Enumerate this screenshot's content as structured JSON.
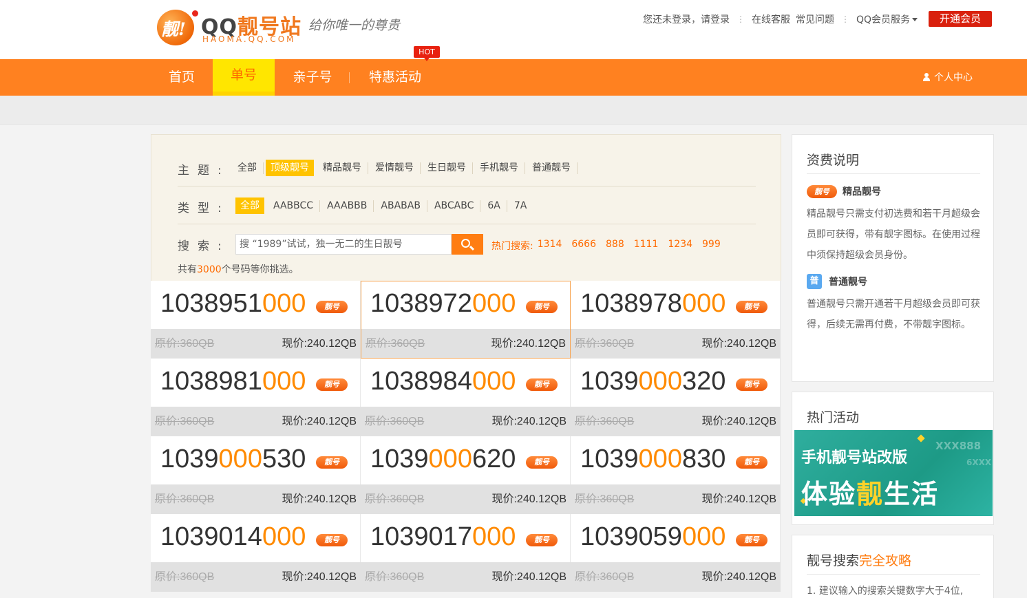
{
  "header": {
    "logo": {
      "badge": "靓!",
      "title_a": "QQ",
      "title_b": "靓号站",
      "domain": "HAOMA.QQ.COM",
      "slogan": "给你唯一的尊贵"
    },
    "links": {
      "login_prompt": "您还未登录，请登录",
      "online_service": "在线客服",
      "faq": "常见问题",
      "vip_service": "QQ会员服务"
    },
    "vip_button": "开通会员"
  },
  "nav": {
    "items": [
      {
        "label": "首页"
      },
      {
        "label": "单号"
      },
      {
        "label": "亲子号"
      },
      {
        "label": "特惠活动"
      }
    ],
    "active_index": 1,
    "hot_badge": "HOT",
    "personal_center": "个人中心"
  },
  "filter": {
    "theme_label": "主题:",
    "themes": [
      "全部",
      "顶级靓号",
      "精品靓号",
      "爱情靓号",
      "生日靓号",
      "手机靓号",
      "普通靓号"
    ],
    "theme_selected": "顶级靓号",
    "type_label": "类型:",
    "types": [
      "全部",
      "AABBCC",
      "AAABBB",
      "ABABAB",
      "ABCABC",
      "6A",
      "7A"
    ],
    "type_selected": "全部",
    "search_label": "搜索:",
    "search_placeholder": "搜 “1989”试试，独一无二的生日靓号",
    "hot_search_label": "热门搜索:",
    "hot_searches": [
      "1314",
      "6666",
      "888",
      "1111",
      "1234",
      "999"
    ],
    "count_prefix": "共有",
    "count_value": "3000",
    "count_suffix": "个号码等你挑选。"
  },
  "numbers": [
    {
      "prefix": "1038951",
      "highlight": "000",
      "suffix": "",
      "tag": "靓号",
      "original": "原价:360QB",
      "current": "现价:240.12QB"
    },
    {
      "prefix": "1038972",
      "highlight": "000",
      "suffix": "",
      "tag": "靓号",
      "original": "原价:360QB",
      "current": "现价:240.12QB"
    },
    {
      "prefix": "1038978",
      "highlight": "000",
      "suffix": "",
      "tag": "靓号",
      "original": "原价:360QB",
      "current": "现价:240.12QB"
    },
    {
      "prefix": "1038981",
      "highlight": "000",
      "suffix": "",
      "tag": "靓号",
      "original": "原价:360QB",
      "current": "现价:240.12QB"
    },
    {
      "prefix": "1038984",
      "highlight": "000",
      "suffix": "",
      "tag": "靓号",
      "original": "原价:360QB",
      "current": "现价:240.12QB"
    },
    {
      "prefix": "1039",
      "highlight": "000",
      "suffix": "320",
      "tag": "靓号",
      "original": "原价:360QB",
      "current": "现价:240.12QB"
    },
    {
      "prefix": "1039",
      "highlight": "000",
      "suffix": "530",
      "tag": "靓号",
      "original": "原价:360QB",
      "current": "现价:240.12QB"
    },
    {
      "prefix": "1039",
      "highlight": "000",
      "suffix": "620",
      "tag": "靓号",
      "original": "原价:360QB",
      "current": "现价:240.12QB"
    },
    {
      "prefix": "1039",
      "highlight": "000",
      "suffix": "830",
      "tag": "靓号",
      "original": "原价:360QB",
      "current": "现价:240.12QB"
    },
    {
      "prefix": "1039014",
      "highlight": "000",
      "suffix": "",
      "tag": "靓号",
      "original": "原价:360QB",
      "current": "现价:240.12QB"
    },
    {
      "prefix": "1039017",
      "highlight": "000",
      "suffix": "",
      "tag": "靓号",
      "original": "原价:360QB",
      "current": "现价:240.12QB"
    },
    {
      "prefix": "1039059",
      "highlight": "000",
      "suffix": "",
      "tag": "靓号",
      "original": "原价:360QB",
      "current": "现价:240.12QB"
    }
  ],
  "sidebar": {
    "fees": {
      "title": "资费说明",
      "premium_tag": "靓号",
      "premium_title": "精品靓号",
      "premium_desc": "精品靓号只需支付初选费和若干月超级会员即可获得，带有靓字图标。在使用过程中须保持超级会员身份。",
      "normal_tag": "普",
      "normal_title": "普通靓号",
      "normal_desc": "普通靓号只需开通若干月超级会员即可获得，后续无需再付费，不带靓字图标。"
    },
    "activity": {
      "title": "热门活动",
      "banner_line1": "手机靓号站改版",
      "banner_line2_a": "体验",
      "banner_line2_b": "靓",
      "banner_line2_c": "生活",
      "banner_deco": "XXX888",
      "banner_deco2": "6XXX"
    },
    "guide": {
      "title_a": "靓号搜索",
      "title_b": "完全攻略",
      "tip1": "1. 建议输入的搜索关键数字大于4位,"
    }
  },
  "colors": {
    "accent": "#ff8120",
    "highlight_digit": "#ff8a00",
    "active_tab": "#ffe600",
    "vip_red": "#d9200d"
  }
}
